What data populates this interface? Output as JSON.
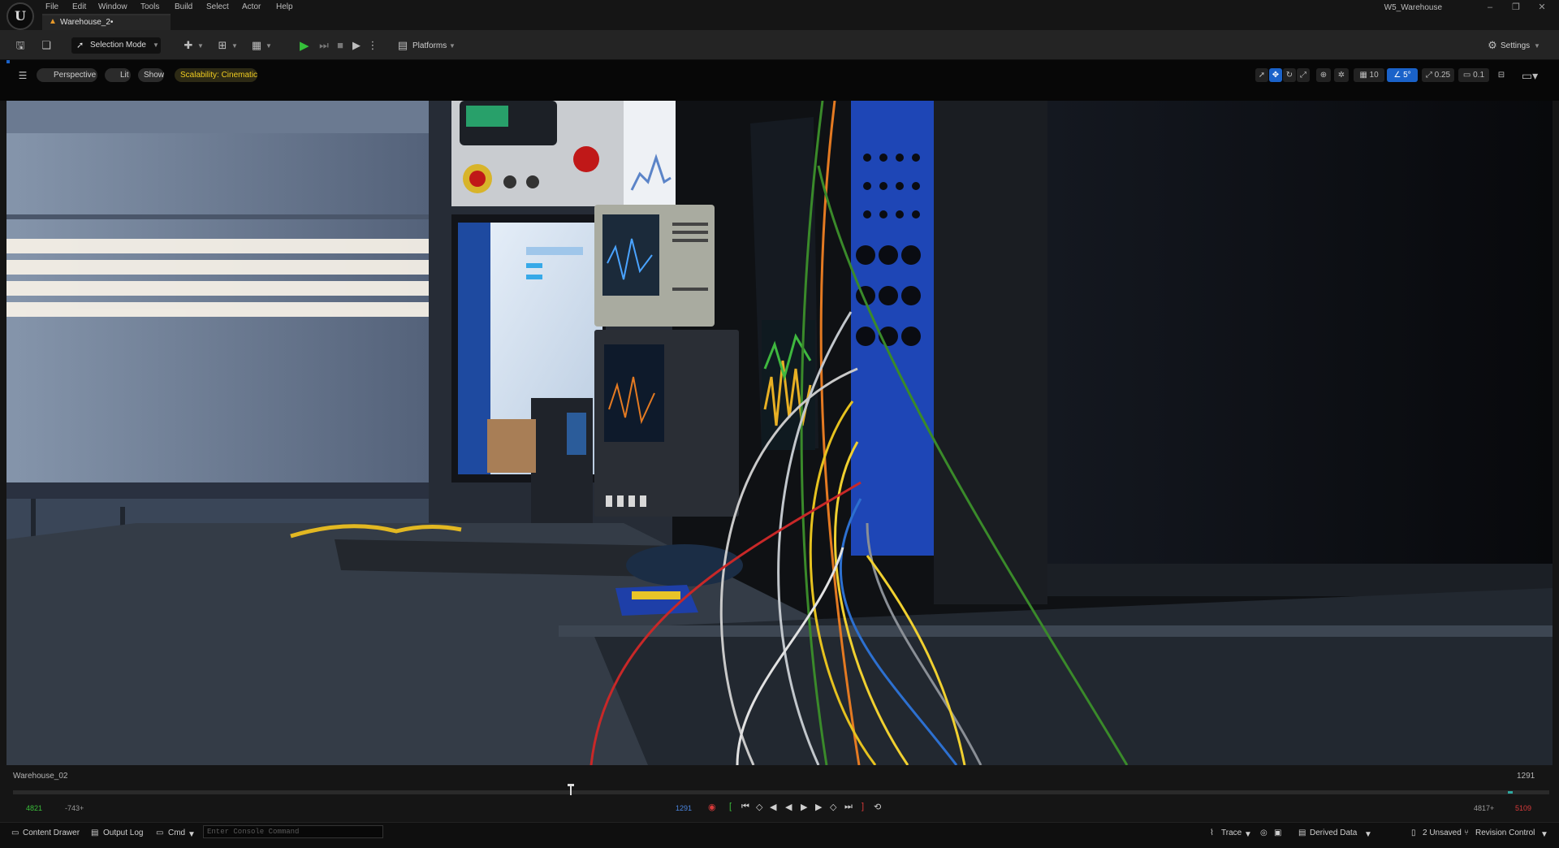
{
  "window": {
    "project_name": "W5_Warehouse",
    "document_tab": "Warehouse_2•"
  },
  "menu": [
    "File",
    "Edit",
    "Window",
    "Tools",
    "Build",
    "Select",
    "Actor",
    "Help"
  ],
  "toolbar": {
    "selection_mode": "Selection Mode",
    "platforms": "Platforms",
    "settings": "Settings"
  },
  "viewport_toolbar": {
    "perspective": "Perspective",
    "lit": "Lit",
    "show": "Show",
    "scalability": "Scalability: Cinematic",
    "grid_snap": "10",
    "rotation_snap": "5°",
    "scale_snap": "0.25",
    "camera_speed": "0.1"
  },
  "sequencer": {
    "sequence_name": "Warehouse_02",
    "current_frame_right": "1291",
    "current_frame": "1291",
    "start_frame": "4821",
    "start_offset": "-743+",
    "end_frame": "4817+",
    "end_frame_red": "5109"
  },
  "statusbar": {
    "content_drawer": "Content Drawer",
    "output_log": "Output Log",
    "cmd": "Cmd",
    "console_placeholder": "Enter Console Command",
    "trace": "Trace",
    "derived_data": "Derived Data",
    "unsaved": "2 Unsaved",
    "revision_control": "Revision Control"
  },
  "colors": {
    "accent_blue": "#1a62c9",
    "play_green": "#35c03a",
    "scalability_yellow": "#f0cc20",
    "record_red": "#d83a3a"
  }
}
